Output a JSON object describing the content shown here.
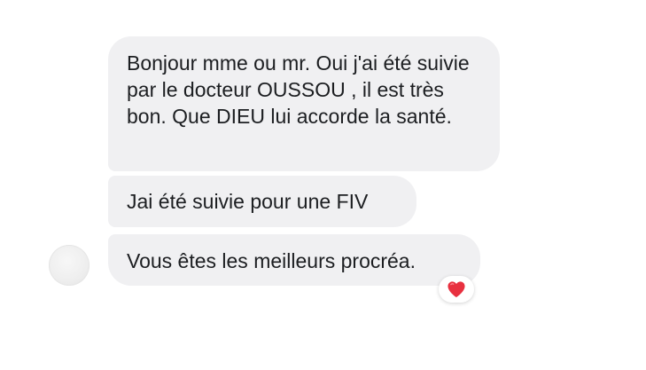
{
  "messages": [
    {
      "text": "Bonjour mme ou mr. Oui j'ai été suivie par le docteur OUSSOU , il est très bon. Que DIEU lui accorde la santé."
    },
    {
      "text": "Jai été suivie pour une FIV"
    },
    {
      "text": "Vous êtes les meilleurs procréa."
    }
  ],
  "reaction": {
    "icon": "heart-icon",
    "color": "#e8303f"
  },
  "colors": {
    "bubble_bg": "#f0f0f2",
    "text": "#1c1e21"
  }
}
